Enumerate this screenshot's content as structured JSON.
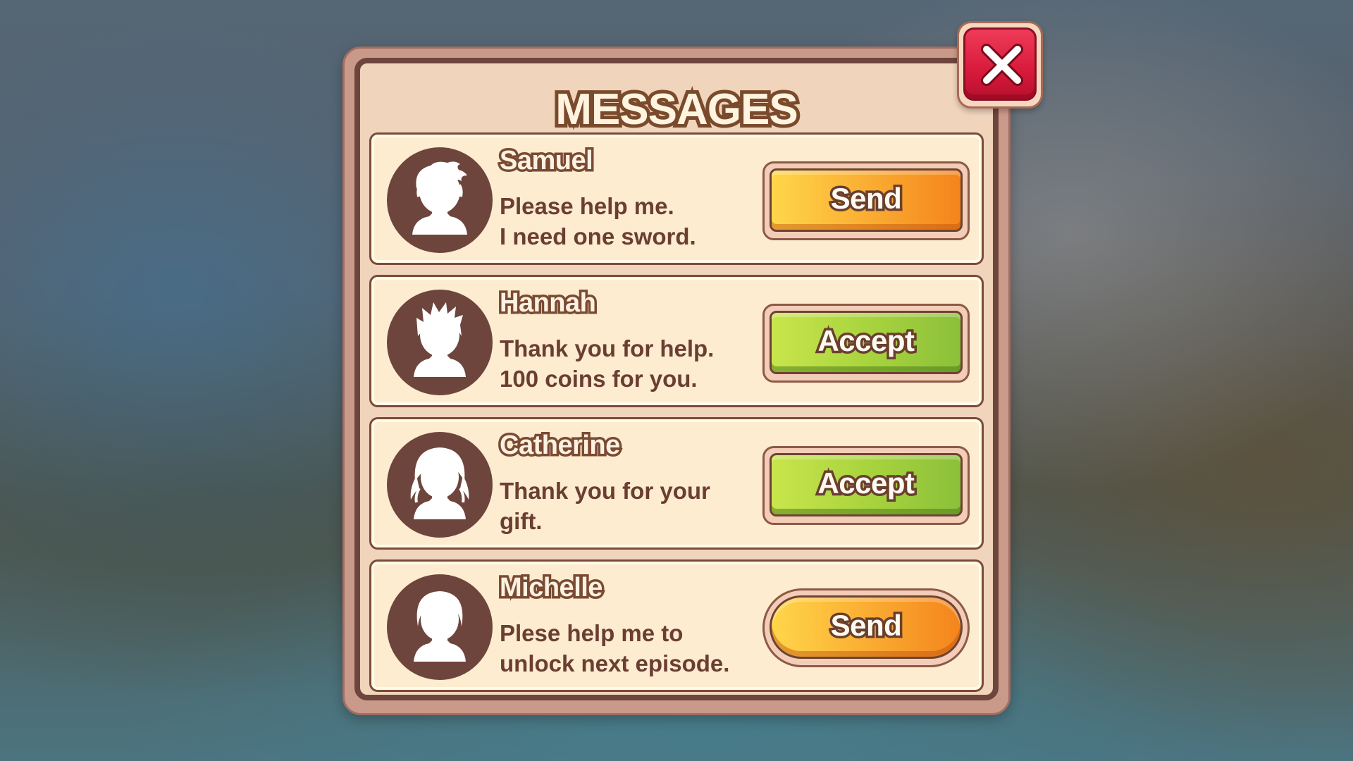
{
  "dialog": {
    "title": "MESSAGES",
    "close_icon": "close-x-icon"
  },
  "colors": {
    "panel_border": "#6e453c",
    "panel_fill": "#f0d4bc",
    "row_fill": "#fdeccf",
    "avatar_fill": "#6d453d",
    "close_red": "#d81a3c",
    "send_orange": "#f4a52a",
    "accept_green": "#a9d43e"
  },
  "messages": [
    {
      "name": "Samuel",
      "avatar_icon": "boy-avatar-icon",
      "lines": [
        "Please help me.",
        "I need one sword."
      ],
      "action": "Send"
    },
    {
      "name": "Hannah",
      "avatar_icon": "spiky-hair-avatar-icon",
      "lines": [
        "Thank you for help.",
        "100 coins for you."
      ],
      "action": "Accept"
    },
    {
      "name": "Catherine",
      "avatar_icon": "girl-avatar-icon",
      "lines": [
        "Thank you for your",
        "gift."
      ],
      "action": "Accept"
    },
    {
      "name": "Michelle",
      "avatar_icon": "short-hair-avatar-icon",
      "lines": [
        "Plese help me to",
        "unlock next episode."
      ],
      "action": "Send"
    }
  ]
}
